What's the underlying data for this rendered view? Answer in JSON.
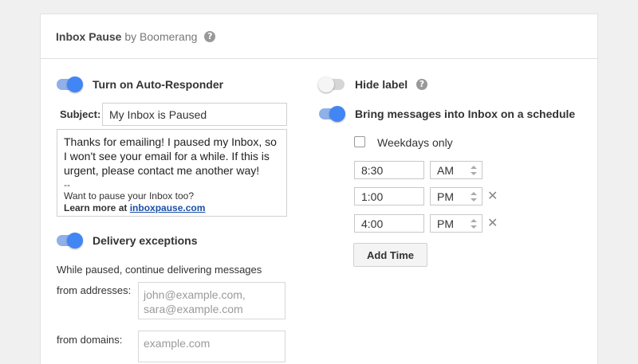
{
  "header": {
    "app_name": "Inbox Pause",
    "by_text": "by Boomerang",
    "help_glyph": "?"
  },
  "auto_responder": {
    "toggle_on": true,
    "label": "Turn on Auto-Responder",
    "subject_label": "Subject:",
    "subject_value": "My Inbox is Paused",
    "message_body": "Thanks for emailing! I paused my Inbox, so I won't see your email for a while. If this is urgent, please contact me another way!",
    "signature_separator": "--",
    "signature_text": "Want to pause your Inbox too?",
    "learn_more_prefix": "Learn more at",
    "learn_more_link": "inboxpause.com"
  },
  "delivery_exceptions": {
    "toggle_on": true,
    "label": "Delivery exceptions",
    "description": "While paused, continue delivering messages",
    "from_addresses_label": "from addresses:",
    "from_addresses_placeholder_line1": "john@example.com,",
    "from_addresses_placeholder_line2": "sara@example.com",
    "from_domains_label": "from domains:",
    "from_domains_placeholder": "example.com"
  },
  "hide_label": {
    "toggle_on": false,
    "label": "Hide label",
    "help_glyph": "?"
  },
  "schedule": {
    "toggle_on": true,
    "label": "Bring messages into Inbox on a schedule",
    "weekdays_label": "Weekdays only",
    "weekdays_checked": false,
    "times": [
      {
        "time": "8:30",
        "period": "AM",
        "removable": false
      },
      {
        "time": "1:00",
        "period": "PM",
        "removable": true
      },
      {
        "time": "4:00",
        "period": "PM",
        "removable": true
      }
    ],
    "remove_glyph": "✕",
    "add_time_label": "Add Time"
  },
  "colors": {
    "toggle_on_knob": "#4285f4",
    "toggle_on_track": "#8fb0e8",
    "link": "#1a4fa8"
  }
}
